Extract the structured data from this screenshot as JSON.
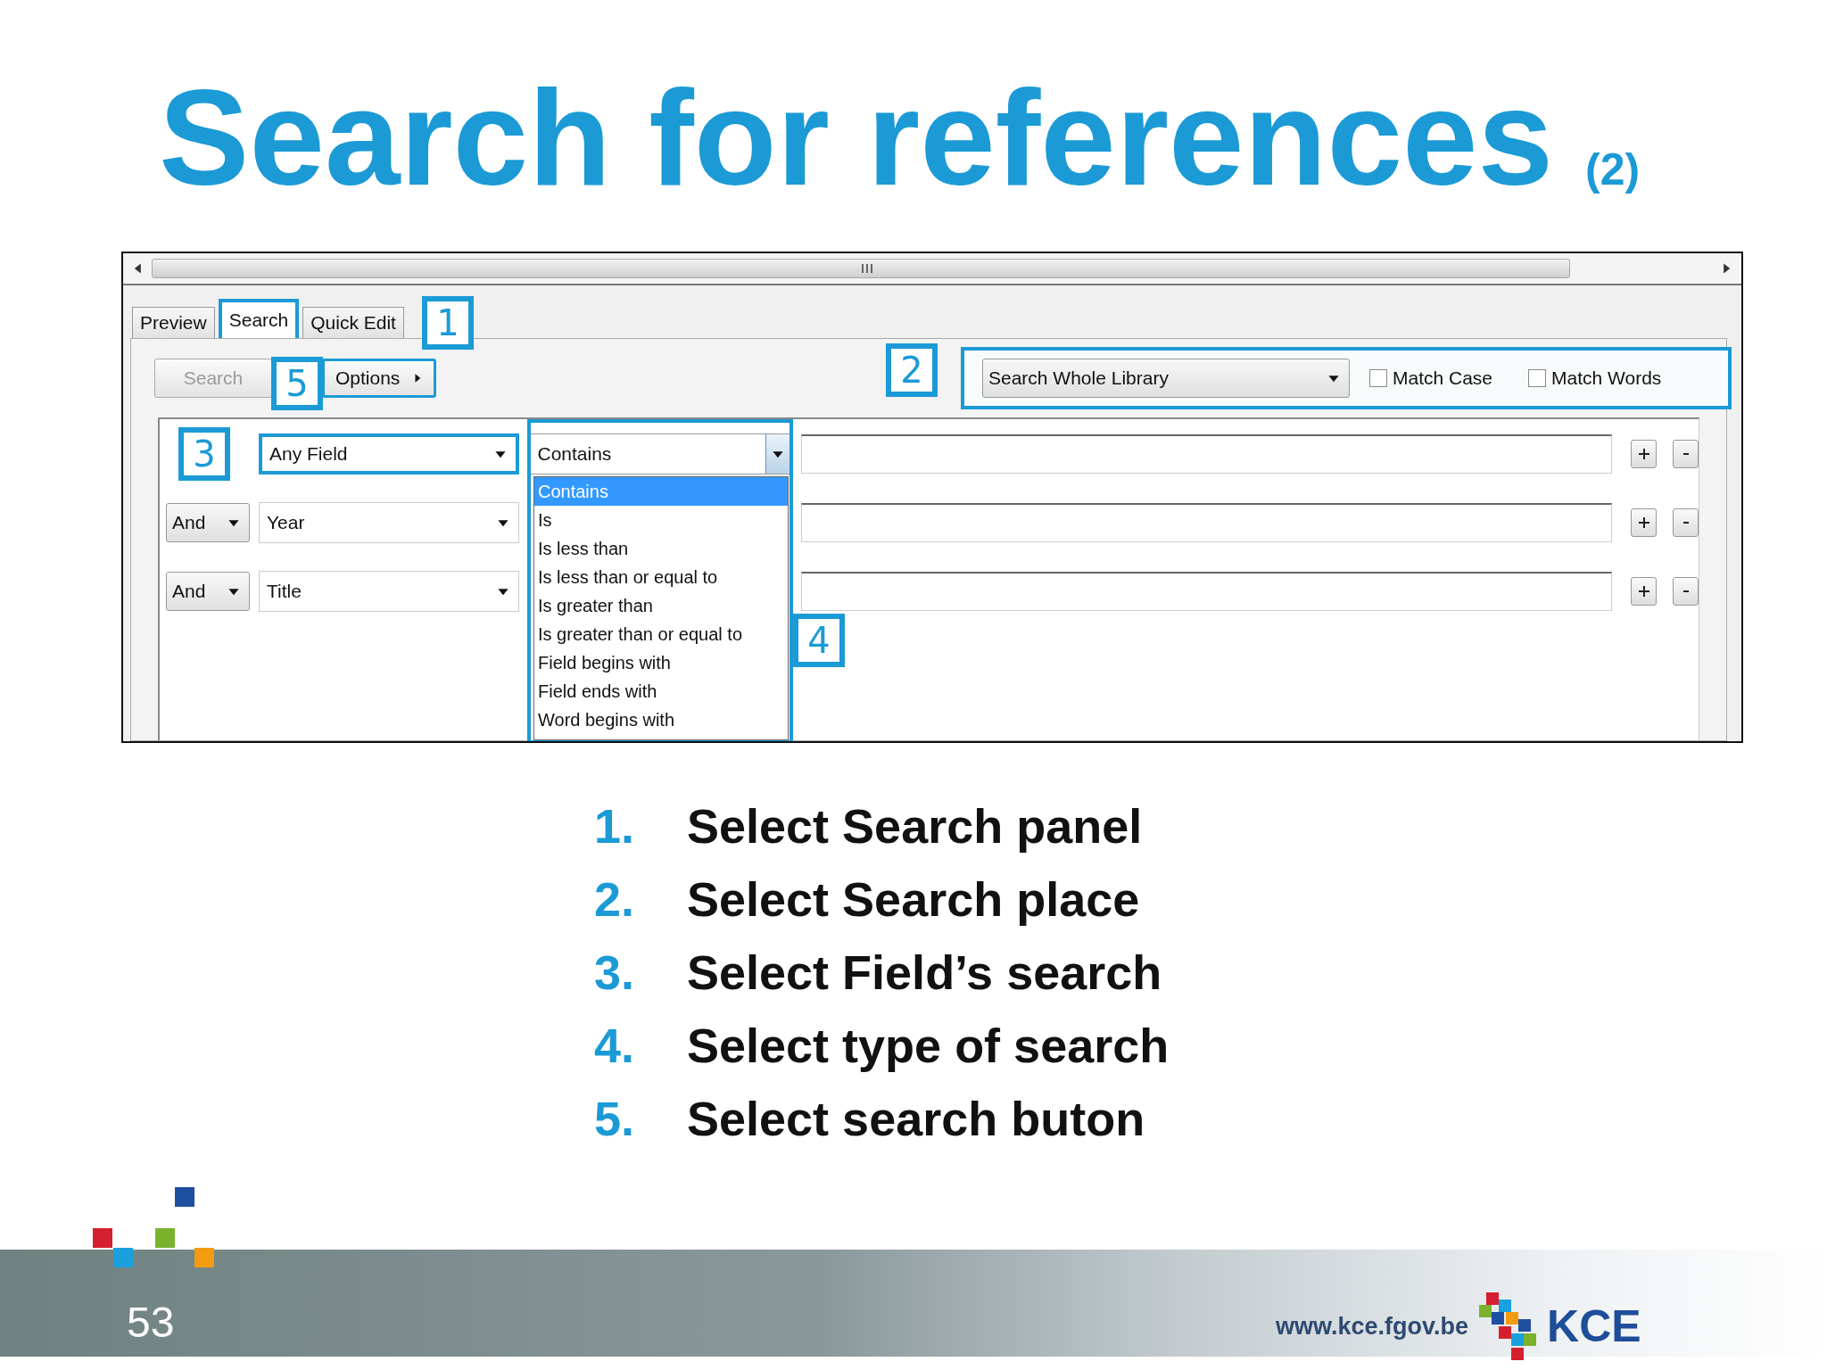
{
  "slide": {
    "title": "Search for references",
    "title_suffix": "(2)"
  },
  "screenshot": {
    "tabs": [
      {
        "label": "Preview",
        "selected": false
      },
      {
        "label": "Search",
        "selected": true
      },
      {
        "label": "Quick Edit",
        "selected": false
      }
    ],
    "search_button": {
      "label": "Search",
      "disabled": true
    },
    "options_button": {
      "label": "Options"
    },
    "scope": {
      "value": "Search Whole Library"
    },
    "checkboxes": [
      {
        "label": "Match Case",
        "checked": false
      },
      {
        "label": "Match Words",
        "checked": false
      }
    ],
    "criteria": [
      {
        "field": "Any Field",
        "operator": "Contains"
      },
      {
        "connector": "And",
        "field": "Year"
      },
      {
        "connector": "And",
        "field": "Title"
      }
    ],
    "operator_list": [
      {
        "label": "Contains",
        "selected": true
      },
      {
        "label": "Is",
        "selected": false
      },
      {
        "label": "Is less than",
        "selected": false
      },
      {
        "label": "Is less than or equal to",
        "selected": false
      },
      {
        "label": "Is greater than",
        "selected": false
      },
      {
        "label": "Is greater than or equal to",
        "selected": false
      },
      {
        "label": "Field begins with",
        "selected": false
      },
      {
        "label": "Field ends with",
        "selected": false
      },
      {
        "label": "Word begins with",
        "selected": false
      }
    ],
    "callouts": [
      "1",
      "5",
      "2",
      "3",
      "4"
    ]
  },
  "steps": [
    {
      "number": "1.",
      "text": "Select Search panel"
    },
    {
      "number": "2.",
      "text": "Select Search place"
    },
    {
      "number": "3.",
      "text": "Select Field’s search"
    },
    {
      "number": "4.",
      "text": "Select type of search"
    },
    {
      "number": "5.",
      "text": "Select search buton"
    }
  ],
  "footer": {
    "page": "53",
    "url": "www.kce.fgov.be",
    "logo": "KCE"
  }
}
